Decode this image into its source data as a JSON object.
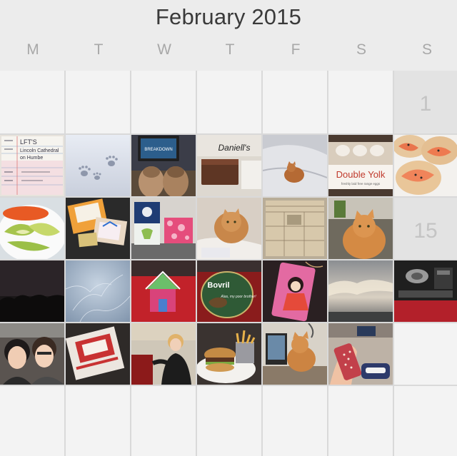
{
  "calendar": {
    "month_title": "February 2015",
    "weekdays": [
      "M",
      "T",
      "W",
      "T",
      "F",
      "S",
      "S"
    ],
    "day_labels": {
      "feb1": "1",
      "feb15": "15"
    }
  },
  "photos": {
    "list_note": {
      "line1": "LFT'S",
      "line2": "Lincoln Cathedral",
      "line3": "on Humbe"
    },
    "tv_screen": "BREAKDOWN",
    "cake_brand": "Daniell's",
    "egg_brand": "Double Yolk",
    "egg_tagline": "freshly laid free range eggs",
    "bovril_label": "Bovril",
    "bovril_slogan": "Alas, my poor brother!"
  },
  "colors": {
    "background": "#ececec",
    "cell": "#f3f3f3",
    "weekend_shade": "#e3e3e3",
    "title_text": "#3a3a3a",
    "weekday_text": "#a8a8a8",
    "day_number": "#c4c4c4"
  }
}
